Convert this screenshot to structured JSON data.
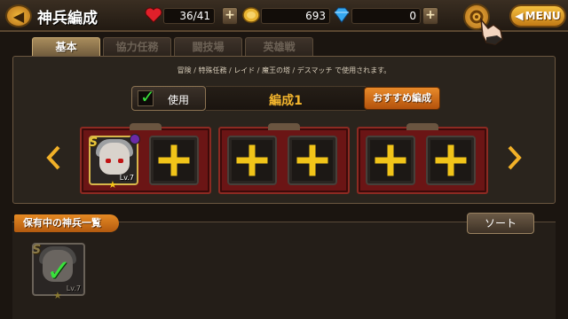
{
  "header": {
    "title": "神兵編成",
    "hearts": "36/41",
    "coins": "693",
    "gems": "0",
    "menu_label": "MENU"
  },
  "tabs": [
    {
      "label": "基本",
      "active": true
    },
    {
      "label": "協力任務",
      "active": false
    },
    {
      "label": "闘技場",
      "active": false
    },
    {
      "label": "英雄戦",
      "active": false
    }
  ],
  "notice": "冒険 / 特殊任務 / レイド / 魔王の塔 / デスマッチ で使用されます。",
  "formation": {
    "use_label": "使用",
    "use_checked": true,
    "name": "編成1",
    "recommend_label": "おすすめ編成"
  },
  "squads": [
    {
      "slots": [
        {
          "filled": true,
          "level": "Lv.7",
          "rank": "S",
          "stars": "★"
        },
        {
          "filled": false
        }
      ]
    },
    {
      "slots": [
        {
          "filled": false
        },
        {
          "filled": false
        }
      ]
    },
    {
      "slots": [
        {
          "filled": false
        },
        {
          "filled": false
        }
      ]
    }
  ],
  "owned": {
    "title": "保有中の神兵一覧",
    "sort_label": "ソート",
    "items": [
      {
        "level": "Lv.7",
        "rank": "S",
        "stars": "★",
        "in_use": true
      }
    ]
  },
  "colors": {
    "accent_orange": "#e58a24",
    "formation_gold": "#f3b52d",
    "squad_red": "#6b1515",
    "check_green": "#39e23c"
  }
}
